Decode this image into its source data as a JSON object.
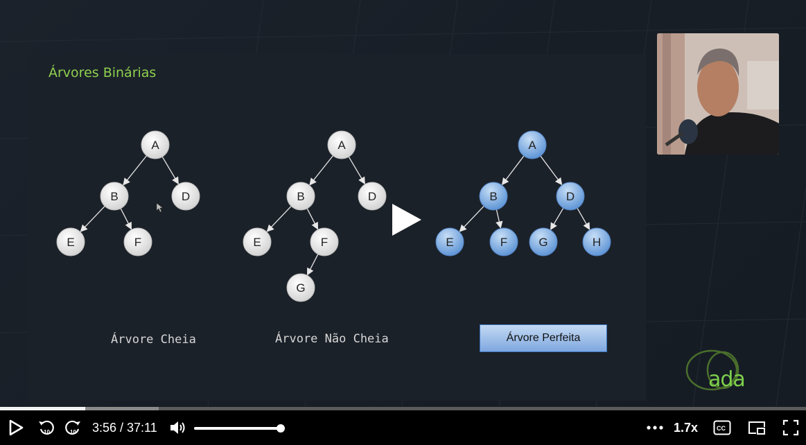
{
  "slide": {
    "title": "Árvores Binárias",
    "trees": [
      {
        "caption": "Árvore Cheia",
        "nodes": [
          "A",
          "B",
          "D",
          "E",
          "F"
        ]
      },
      {
        "caption": "Árvore Não Cheia",
        "nodes": [
          "A",
          "B",
          "D",
          "E",
          "F",
          "G"
        ]
      },
      {
        "caption": "Árvore Perfeita",
        "nodes": [
          "A",
          "B",
          "D",
          "E",
          "F",
          "G",
          "H"
        ]
      }
    ]
  },
  "logo": {
    "text": "ada",
    "color": "#7ed04b"
  },
  "player": {
    "current_time": "3:56",
    "duration": "37:11",
    "time_display": "3:56 / 37:11",
    "progress_played_fraction": 0.1058,
    "progress_buffered_fraction": 0.197,
    "volume_fraction": 1.0,
    "speed": "1.7x",
    "icons": {
      "play": "play-icon",
      "rewind": "rewind-10-icon",
      "forward": "forward-10-icon",
      "volume": "volume-icon",
      "more": "more-icon",
      "captions": "cc-icon",
      "pip": "pip-icon",
      "fullscreen": "fullscreen-icon"
    }
  },
  "colors": {
    "accent": "#8fd14f",
    "perfect_node": "#7aaee6",
    "plain_node": "#ececec"
  }
}
